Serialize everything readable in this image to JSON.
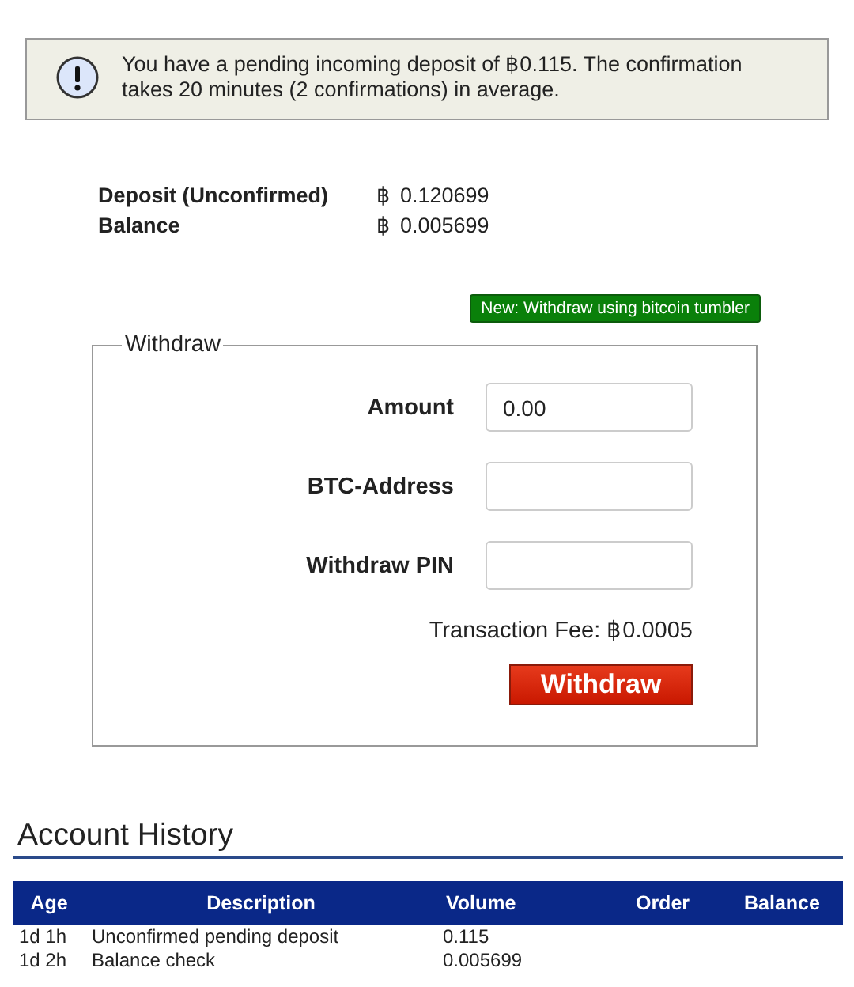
{
  "notice": {
    "text": "You have a pending incoming deposit of ฿0.115. The confirmation takes 20 minutes (2 confirmations) in average."
  },
  "balances": [
    {
      "label": "Deposit (Unconfirmed)",
      "currency": "฿",
      "amount": "0.120699"
    },
    {
      "label": "Balance",
      "currency": "฿",
      "amount": "0.005699"
    }
  ],
  "tumbler_link": "New: Withdraw using bitcoin tumbler",
  "withdraw": {
    "legend": "Withdraw",
    "fields": [
      {
        "label": "Amount",
        "value": "0.00"
      },
      {
        "label": "BTC-Address"
      },
      {
        "label": "Withdraw PIN"
      }
    ],
    "fee": "Transaction Fee: ฿0.0005",
    "button": "Withdraw"
  },
  "history": {
    "title": "Account History",
    "columns": [
      "Age",
      "Description",
      "Volume",
      "Order",
      "Balance"
    ],
    "rows": [
      [
        "1d 1h",
        "Unconfirmed pending deposit",
        "0.115",
        "",
        ""
      ],
      [
        "1d 2h",
        "Balance check",
        "0.005699",
        "",
        ""
      ]
    ]
  }
}
